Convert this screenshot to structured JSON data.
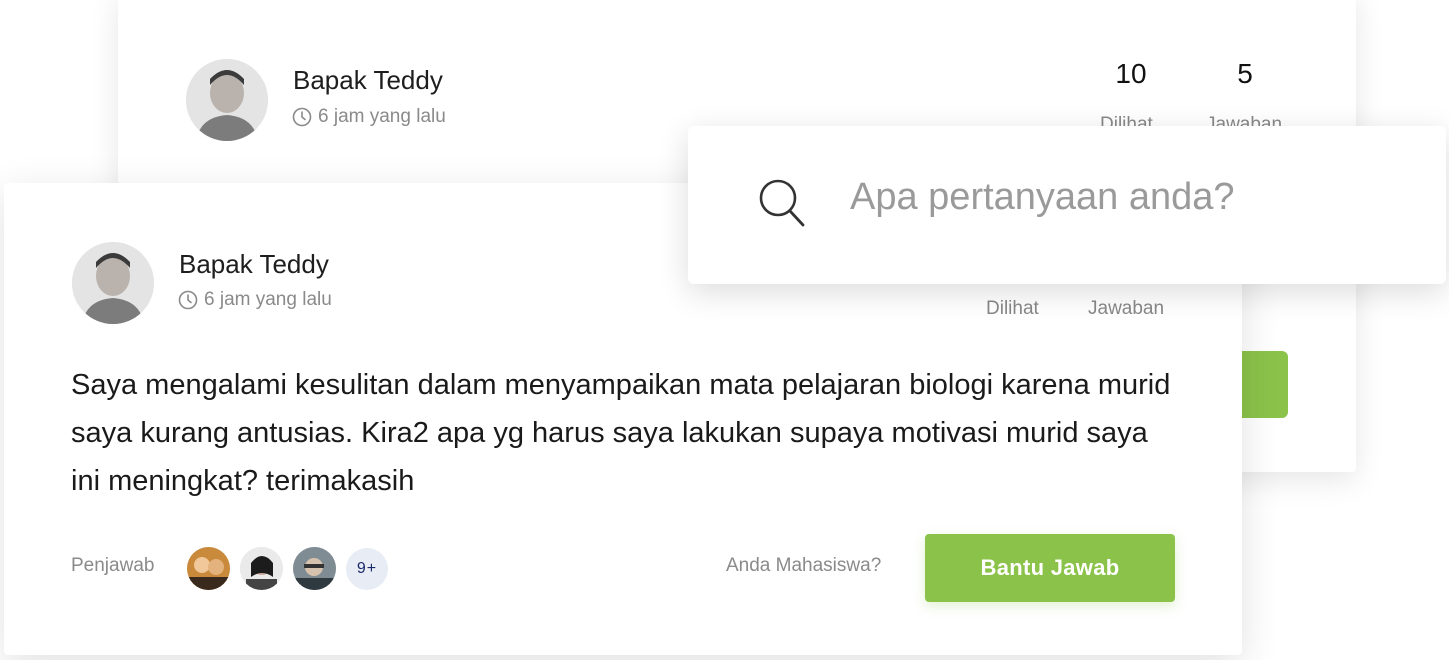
{
  "back_card": {
    "author": "Bapak Teddy",
    "time": "6 jam yang lalu",
    "views_count": "10",
    "answers_count": "5",
    "views_label": "Dilihat",
    "answers_label": "Jawaban"
  },
  "front_card": {
    "author": "Bapak Teddy",
    "time": "6 jam yang lalu",
    "views_label": "Dilihat",
    "answers_label": "Jawaban",
    "question": "Saya mengalami kesulitan dalam menyampaikan mata pelajaran biologi karena murid saya kurang antusias. Kira2 apa yg harus saya lakukan supaya motivasi murid saya ini meningkat? terimakasih",
    "answerers_label": "Penjawab",
    "more_answerers": "9+",
    "student_prompt": "Anda Mahasiswa?",
    "help_button": "Bantu Jawab"
  },
  "search": {
    "placeholder": "Apa pertanyaan anda?"
  },
  "colors": {
    "accent": "#8bc34a",
    "muted_text": "#8a8a8a",
    "badge_bg": "#e8ecf5",
    "badge_text": "#1b2a6b"
  }
}
